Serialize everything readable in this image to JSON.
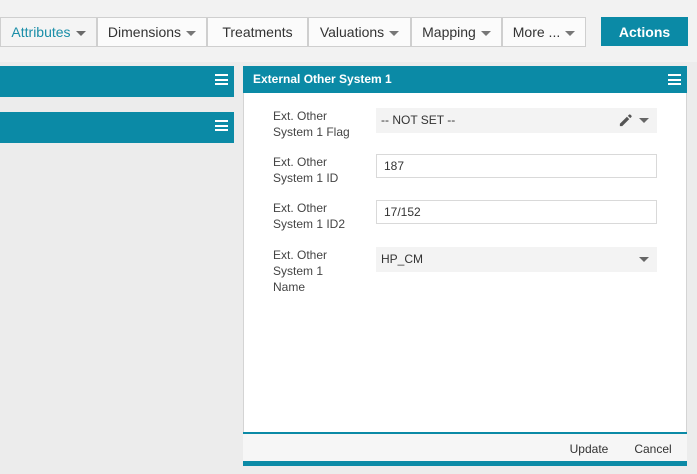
{
  "tabs": [
    {
      "label": "Attributes",
      "has_caret": true,
      "active": true
    },
    {
      "label": "Dimensions",
      "has_caret": true,
      "active": false
    },
    {
      "label": "Treatments",
      "has_caret": false,
      "active": false
    },
    {
      "label": "Valuations",
      "has_caret": true,
      "active": false
    },
    {
      "label": "Mapping",
      "has_caret": true,
      "active": false
    },
    {
      "label": "More ...",
      "has_caret": true,
      "active": false
    }
  ],
  "actions_label": "Actions",
  "left_panels": [
    {
      "icon": "hamburger-menu-icon"
    },
    {
      "icon": "hamburger-menu-icon"
    }
  ],
  "panel": {
    "title": "External Other System 1",
    "fields": {
      "flag": {
        "label": "Ext. Other System 1 Flag",
        "value": "-- NOT SET --"
      },
      "id": {
        "label": "Ext. Other System 1 ID",
        "value": "187"
      },
      "id2": {
        "label": "Ext. Other System 1 ID2",
        "value": "17/152"
      },
      "name": {
        "label": "Ext. Other System 1 Name",
        "value": "HP_CM"
      }
    },
    "update_label": "Update",
    "cancel_label": "Cancel"
  },
  "colors": {
    "accent": "#0b8aa6",
    "active_tab_text": "#1a8ea8"
  }
}
